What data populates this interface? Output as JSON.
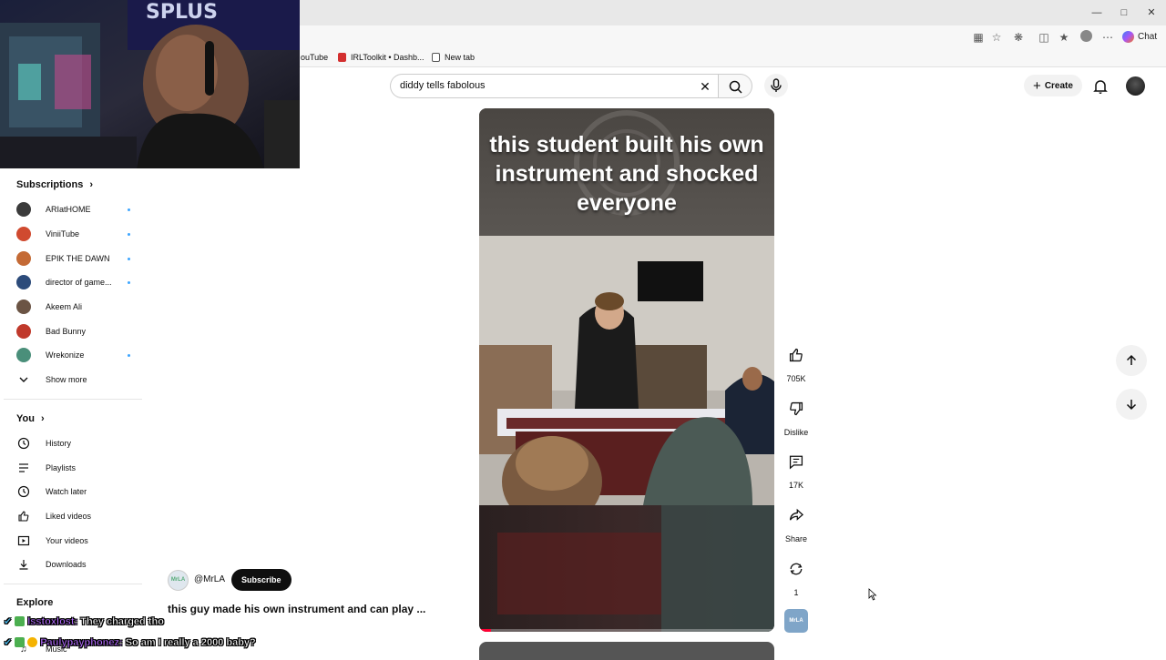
{
  "browser": {
    "chat_label": "Chat",
    "bookmarks": [
      "ouTube",
      "IRLToolkit • Dashb...",
      "New tab"
    ]
  },
  "search": {
    "query": "diddy tells fabolous"
  },
  "header": {
    "create_label": "Create"
  },
  "sidebar": {
    "subscriptions_heading": "Subscriptions",
    "subscriptions": [
      {
        "name": "ARIatHOME",
        "color": "#3b3b3b",
        "new": true
      },
      {
        "name": "ViniiTube",
        "color": "#d04a2f",
        "new": true
      },
      {
        "name": "EPIK THE DAWN",
        "color": "#c46a35",
        "new": true
      },
      {
        "name": "director of game...",
        "color": "#2c4b7a",
        "new": true
      },
      {
        "name": "Akeem Ali",
        "color": "#6b5444",
        "new": false
      },
      {
        "name": "Bad Bunny",
        "color": "#c0392b",
        "new": false
      },
      {
        "name": "Wrekonize",
        "color": "#4a8f7a",
        "new": true
      }
    ],
    "show_more": "Show more",
    "you_heading": "You",
    "you_items": [
      "History",
      "Playlists",
      "Watch later",
      "Liked videos",
      "Your videos",
      "Downloads"
    ],
    "explore_heading": "Explore",
    "explore_partial": "Music"
  },
  "video": {
    "caption": "this student built his own instrument and shocked everyone",
    "channel": "@MrLA",
    "channel_avatar_text": "MrLA",
    "subscribe_label": "Subscribe",
    "title": "this guy made his own instrument and can play ...",
    "progress": 0.04
  },
  "actions": {
    "likes": "705K",
    "dislike_label": "Dislike",
    "comments": "17K",
    "share_label": "Share",
    "remix_count": "1"
  },
  "chat": [
    {
      "user": "lsstoxlost:",
      "message": "They charged tho"
    },
    {
      "user": "Paulypayphonez:",
      "message": "So am I really a 2000 baby?"
    }
  ]
}
